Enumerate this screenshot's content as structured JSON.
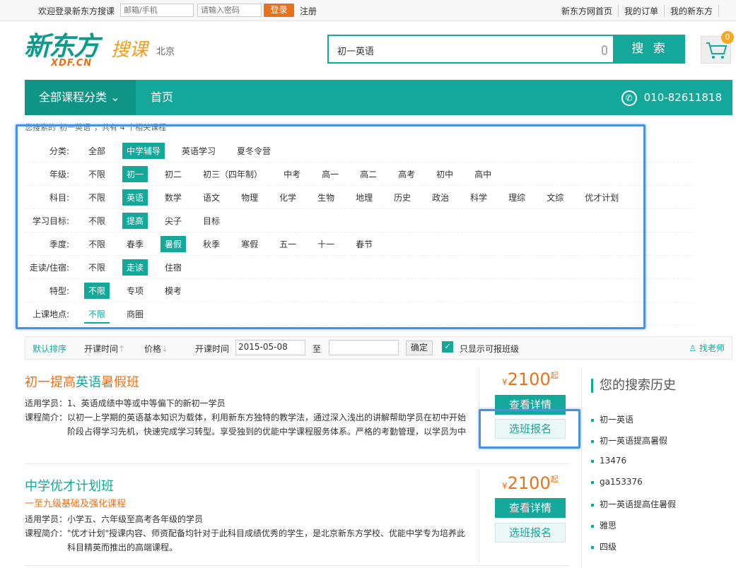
{
  "topbar": {
    "welcome": "欢迎登录新东方搜课",
    "email_placeholder": "邮箱/手机",
    "password_placeholder": "请输入密码",
    "login": "登录",
    "register": "注册",
    "links": [
      "新东方网首页",
      "我的订单",
      "我的新东方"
    ]
  },
  "header": {
    "logo_cn": "新东方",
    "logo_en": "XDF.CN",
    "logo_sub": "搜课",
    "city": "北京",
    "search_value": "初一英语",
    "search_button": "搜 索",
    "cart_count": "0"
  },
  "nav": {
    "all_categories": "全部课程分类",
    "home": "首页",
    "phone": "010-82611818"
  },
  "result_text": "您搜索的\"初一英语\"，共有 4 个相关课程",
  "filters": [
    {
      "label": "分类:",
      "items": [
        "全部",
        "中学辅导",
        "英语学习",
        "夏冬令营"
      ],
      "selected": 1
    },
    {
      "label": "年级:",
      "items": [
        "不限",
        "初一",
        "初二",
        "初三（四年制）",
        "中考",
        "高一",
        "高二",
        "高考",
        "初中",
        "高中"
      ],
      "selected": 1
    },
    {
      "label": "科目:",
      "items": [
        "不限",
        "英语",
        "数学",
        "语文",
        "物理",
        "化学",
        "生物",
        "地理",
        "历史",
        "政治",
        "科学",
        "理综",
        "文综",
        "优才计划"
      ],
      "selected": 1
    },
    {
      "label": "学习目标:",
      "items": [
        "不限",
        "提高",
        "尖子",
        "目标"
      ],
      "selected": 1
    },
    {
      "label": "季度:",
      "items": [
        "不限",
        "春季",
        "暑假",
        "秋季",
        "寒假",
        "五一",
        "十一",
        "春节"
      ],
      "selected": 2
    },
    {
      "label": "走读/住宿:",
      "items": [
        "不限",
        "走读",
        "住宿"
      ],
      "selected": 1
    },
    {
      "label": "特型:",
      "items": [
        "不限",
        "专项",
        "模考"
      ],
      "selected": 0
    },
    {
      "label": "上课地点:",
      "items": [
        "不限",
        "商圈"
      ],
      "selected": 0
    }
  ],
  "sortbar": {
    "default": "默认排序",
    "start_time": "开课时间",
    "price": "价格",
    "start_label": "开课时间",
    "date_from": "2015-05-08",
    "to": "至",
    "date_to": "",
    "ok": "确定",
    "only_available": "只显示可报班级",
    "find_teacher": "找老师"
  },
  "courses": [
    {
      "title": "初一提高英语暑假班",
      "subtitle": "",
      "target_label": "适用学员：",
      "target": "1、英语成绩中等或中等偏下的新初一学员",
      "intro_label": "课程简介：",
      "intro": "以初一上学期的英语基本知识为载体，利用新东方独特的教学法，通过深入浅出的讲解帮助学员在初中开始阶段占得学习先机，快速完成学习转型。享受独到的优能中学课程服务体系。严格的考勤管理，以学员为中",
      "price_symbol": "¥",
      "price": "2100",
      "price_suffix": "起",
      "detail": "查看详情",
      "enroll": "选班报名"
    },
    {
      "title": "中学优才计划班",
      "subtitle": "一至九级基础及强化课程",
      "target_label": "适用学员：",
      "target": "小学五、六年级至高考各年级的学员",
      "intro_label": "课程简介：",
      "intro": "\"优才计划\"授课内容、师资配备均针对于此科目成绩优秀的学生，是北京新东方学校、优能中学专为培养此科目精英而推出的高端课程。",
      "price_symbol": "¥",
      "price": "2100",
      "price_suffix": "起",
      "detail": "查看详情",
      "enroll": "选班报名"
    }
  ],
  "history": {
    "title": "您的搜索历史",
    "items": [
      "初一英语",
      "初一英语提高暑假",
      "13476",
      "ga153376",
      "初一英语提高住暑假",
      "雅思",
      "四级"
    ]
  },
  "colors": {
    "brand": "#14a89a",
    "accent": "#e8711a",
    "highlight": "#4a90e2"
  }
}
